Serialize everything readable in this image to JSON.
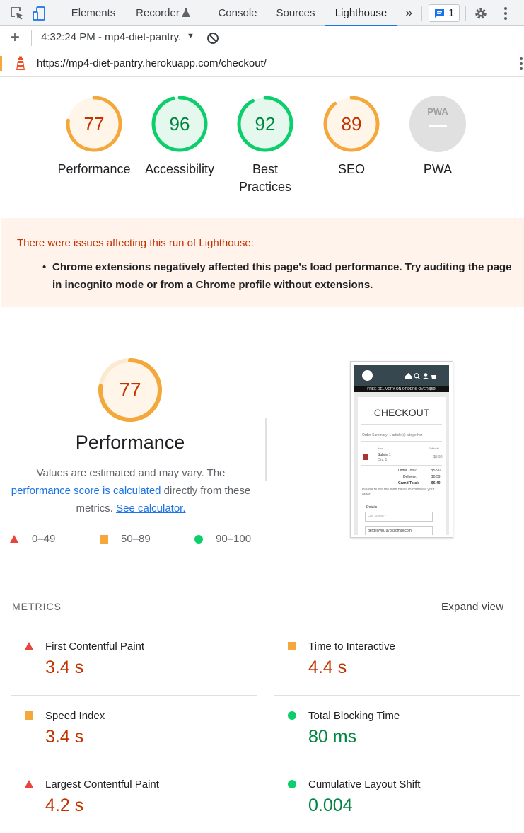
{
  "devtools": {
    "tabs": [
      "Elements",
      "Recorder",
      "Console",
      "Sources",
      "Lighthouse"
    ],
    "active_tab": "Lighthouse",
    "more_tabs_glyph": "»",
    "issues_count": "1",
    "icons": [
      "inspect-element-icon",
      "device-toggle-icon",
      "flask-icon",
      "issues-icon",
      "settings-gear-icon",
      "kebab-menu-icon"
    ]
  },
  "toolbar": {
    "add_glyph": "+",
    "run_label": "4:32:24 PM - mp4-diet-pantry.",
    "dropdown_glyph": "▼"
  },
  "urlbar": {
    "url": "https://mp4-diet-pantry.herokuapp.com/checkout/"
  },
  "scores": [
    {
      "label": "Performance",
      "value": "77",
      "fraction": 0.77,
      "status": "average"
    },
    {
      "label": "Accessibility",
      "value": "96",
      "fraction": 0.96,
      "status": "pass"
    },
    {
      "label": "Best Practices",
      "value": "92",
      "fraction": 0.92,
      "status": "pass"
    },
    {
      "label": "SEO",
      "value": "89",
      "fraction": 0.89,
      "status": "average"
    },
    {
      "label": "PWA",
      "value": "",
      "fraction": 0,
      "status": "na",
      "badge": "PWA"
    }
  ],
  "warning": {
    "title": "There were issues affecting this run of Lighthouse:",
    "items": [
      "Chrome extensions negatively affected this page's load performance. Try auditing the page in incognito mode or from a Chrome profile without extensions."
    ]
  },
  "performance": {
    "score": "77",
    "fraction": 0.77,
    "title": "Performance",
    "desc_prefix": "Values are estimated and may vary. The ",
    "desc_link": "performance score is calculated",
    "desc_middle": " directly from these metrics. ",
    "desc_link2": "See calculator.",
    "legend": [
      {
        "range": "0–49",
        "shape": "triangle",
        "color": "#e8453c"
      },
      {
        "range": "50–89",
        "shape": "square",
        "color": "#f4a73a"
      },
      {
        "range": "90–100",
        "shape": "circle",
        "color": "#0cce6b"
      }
    ]
  },
  "thumbnail": {
    "banner": "FREE DELIVERY ON ORDERS OVER $50!",
    "heading": "CHECKOUT",
    "order_summary": "Order Summary: 1 article(s) altogether",
    "col_item": "Item",
    "col_subtotal": "Subtotal",
    "product": "Subrin 1",
    "qty": "Qty: 1",
    "product_price": "$5.90",
    "order_total_label": "Order Total:",
    "order_total": "$5.90",
    "delivery_label": "Delivery:",
    "delivery": "$0.59",
    "grand_total_label": "Grand Total:",
    "grand_total": "$6.49",
    "instructions": "Please fill out the form below to complete your order",
    "details_label": "Details",
    "full_name_placeholder": "Full Name *",
    "email_value": "gergelyvig1978@gmail.com"
  },
  "metrics": {
    "heading": "METRICS",
    "expand_label": "Expand view",
    "items": [
      {
        "name": "First Contentful Paint",
        "value": "3.4 s",
        "status": "fail"
      },
      {
        "name": "Time to Interactive",
        "value": "4.4 s",
        "status": "average"
      },
      {
        "name": "Speed Index",
        "value": "3.4 s",
        "status": "average"
      },
      {
        "name": "Total Blocking Time",
        "value": "80 ms",
        "status": "pass"
      },
      {
        "name": "Largest Contentful Paint",
        "value": "4.2 s",
        "status": "fail"
      },
      {
        "name": "Cumulative Layout Shift",
        "value": "0.004",
        "status": "pass"
      }
    ]
  },
  "colors": {
    "fail": "#e8453c",
    "average": "#f4a73a",
    "pass": "#0cce6b",
    "fail_text": "#c33300",
    "pass_text": "#018642",
    "accent": "#1a73e8"
  }
}
